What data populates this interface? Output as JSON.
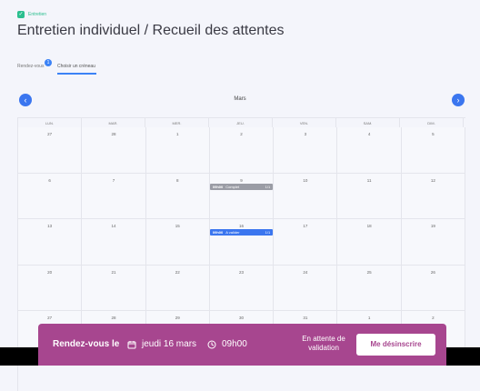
{
  "header": {
    "badge_label": "Entretien",
    "title": "Entretien individuel / Recueil des attentes"
  },
  "tabs": [
    {
      "label": "Rendez-vous",
      "count": "1"
    },
    {
      "label": "Choisir un créneau"
    }
  ],
  "calendar": {
    "month": "Mars",
    "prev_icon": "chevron-left-icon",
    "next_icon": "chevron-right-icon",
    "weekdays": [
      "LUN.",
      "MAR.",
      "MER.",
      "JEU.",
      "VEN.",
      "SAM.",
      "DIM."
    ],
    "weeks": [
      [
        "27",
        "28",
        "1",
        "2",
        "3",
        "4",
        "5"
      ],
      [
        "6",
        "7",
        "8",
        "9",
        "10",
        "11",
        "12"
      ],
      [
        "13",
        "14",
        "15",
        "16",
        "17",
        "18",
        "19"
      ],
      [
        "20",
        "21",
        "22",
        "23",
        "24",
        "25",
        "26"
      ],
      [
        "27",
        "28",
        "29",
        "30",
        "31",
        "1",
        "2"
      ]
    ],
    "events": [
      {
        "week": 1,
        "day": 3,
        "time": "09h00",
        "label": "Complet",
        "ratio": "1/1",
        "color": "#9a9ca5"
      },
      {
        "week": 2,
        "day": 3,
        "time": "09h00",
        "label": "A valider",
        "ratio": "1/1",
        "color": "#3b76ef"
      }
    ]
  },
  "booking_bar": {
    "label": "Rendez-vous le",
    "date": "jeudi 16 mars",
    "time": "09h00",
    "status": "En attente de validation",
    "button": "Me désinscrire",
    "color": "#a7468f"
  }
}
